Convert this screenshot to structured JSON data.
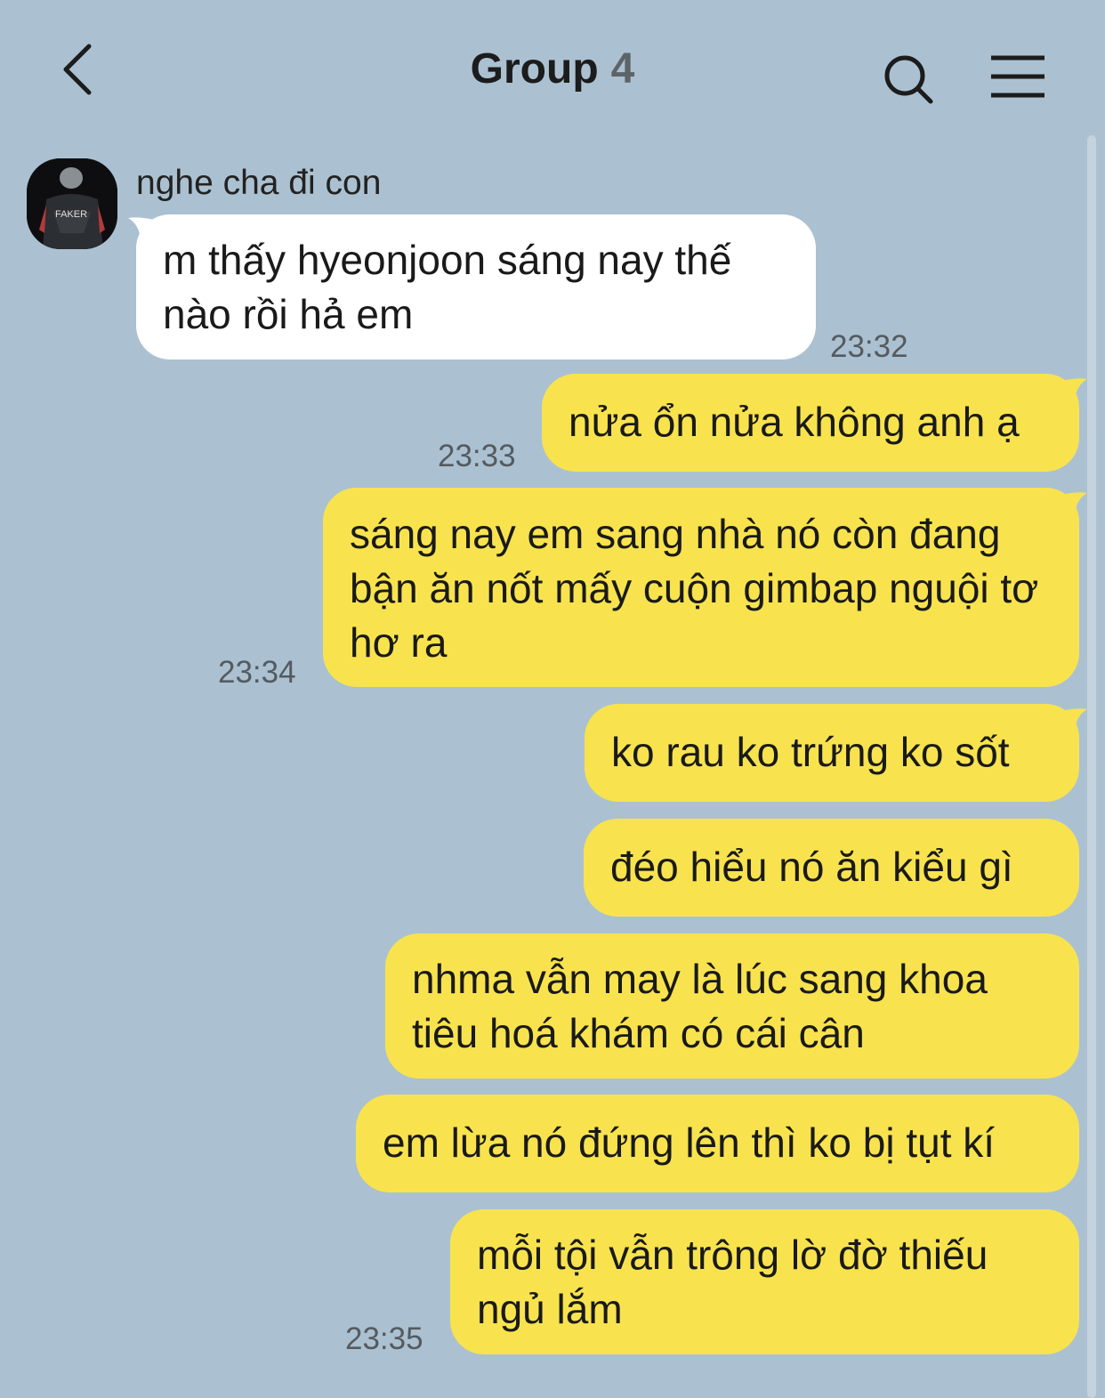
{
  "header": {
    "title": "Group",
    "member_count": "4",
    "back_icon": "chevron-left-icon",
    "search_icon": "search-icon",
    "menu_icon": "hamburger-menu-icon"
  },
  "incoming": {
    "sender_name": "nghe cha đi con",
    "avatar_text": "FAKER",
    "message": "m thấy hyeonjoon sáng nay thế nào rồi hả em",
    "time": "23:32"
  },
  "outgoing": [
    {
      "text": "nửa ổn nửa không anh ạ",
      "time": "23:33"
    },
    {
      "text": "sáng nay em sang nhà nó còn đang bận ăn nốt mấy cuộn gimbap nguội tơ hơ ra",
      "time": "23:34"
    },
    {
      "text": "ko rau ko trứng ko sốt",
      "time": ""
    },
    {
      "text": "đéo hiểu nó ăn kiểu gì",
      "time": ""
    },
    {
      "text": "nhma vẫn may là lúc sang khoa tiêu hoá khám có cái cân",
      "time": ""
    },
    {
      "text": "em lừa nó đứng lên thì ko bị tụt kí",
      "time": ""
    },
    {
      "text": "mỗi tội vẫn trông lờ đờ thiếu ngủ lắm",
      "time": "23:35"
    }
  ],
  "colors": {
    "background": "#abc1d1",
    "incoming_bubble": "#ffffff",
    "outgoing_bubble": "#f8e34e"
  }
}
